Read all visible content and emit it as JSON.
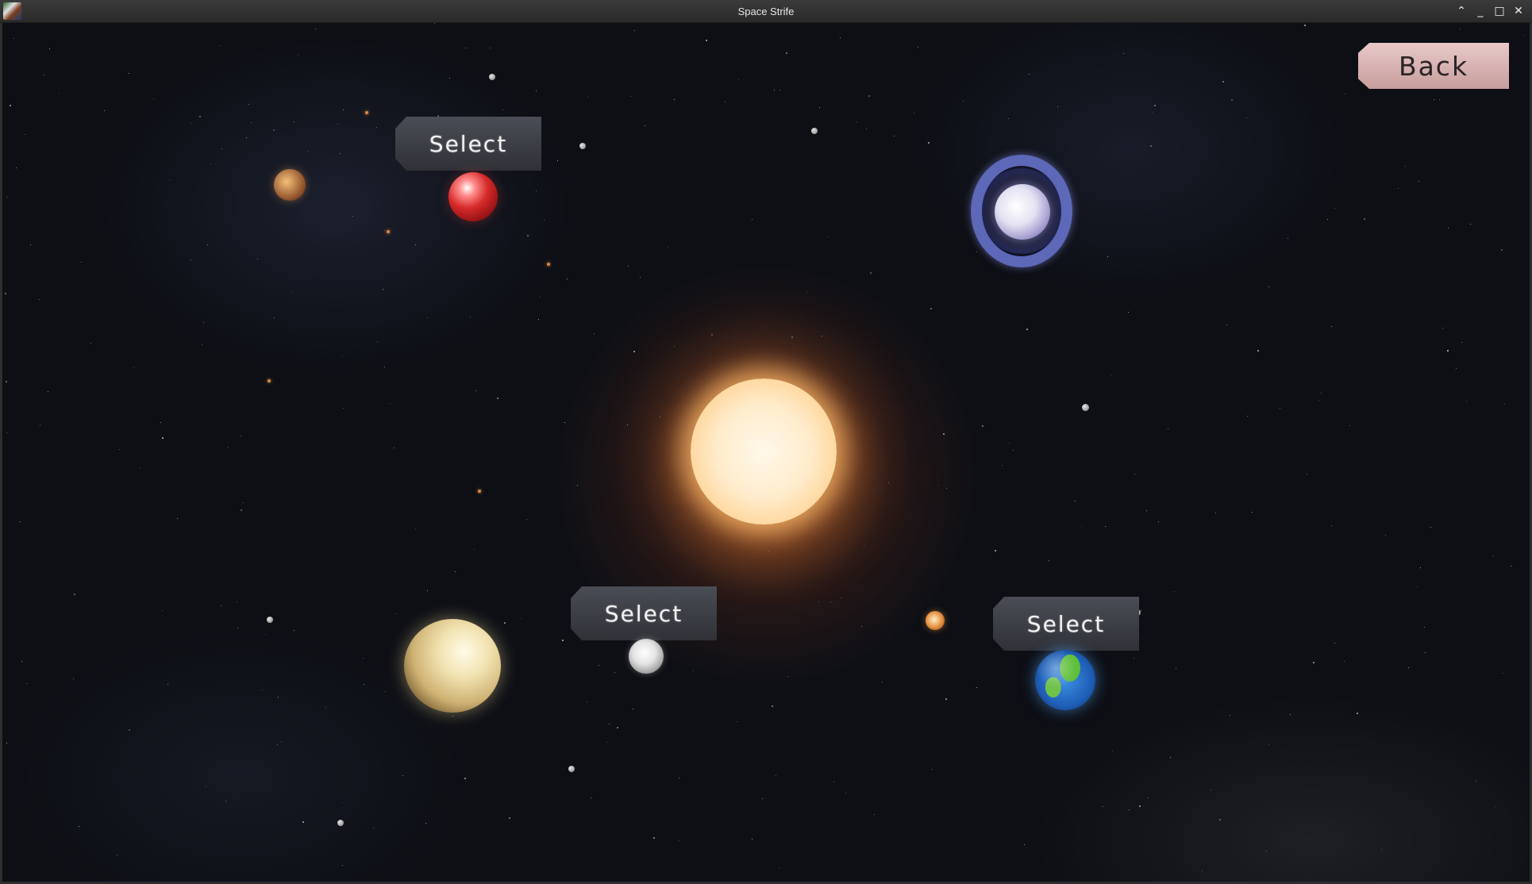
{
  "window": {
    "title": "Space Strife",
    "controls": {
      "up": "⌃",
      "minimize": "_",
      "maximize": "□",
      "close": "✕"
    }
  },
  "menu": {
    "back_label": "Back",
    "select_label": "Select"
  },
  "colors": {
    "background": "#0d0f15",
    "select_button": "#3c3f46",
    "back_button": "#dcb5b5",
    "sun": "#ffe8c4"
  },
  "planets": [
    {
      "name": "red-planet-icon",
      "selectable": true
    },
    {
      "name": "ringed-planet-icon",
      "selectable": false
    },
    {
      "name": "moon-planet-icon",
      "selectable": true
    },
    {
      "name": "earth-planet-icon",
      "selectable": true
    },
    {
      "name": "yellow-planet-icon",
      "selectable": false
    },
    {
      "name": "small-orange-planet-icon",
      "selectable": false
    }
  ]
}
